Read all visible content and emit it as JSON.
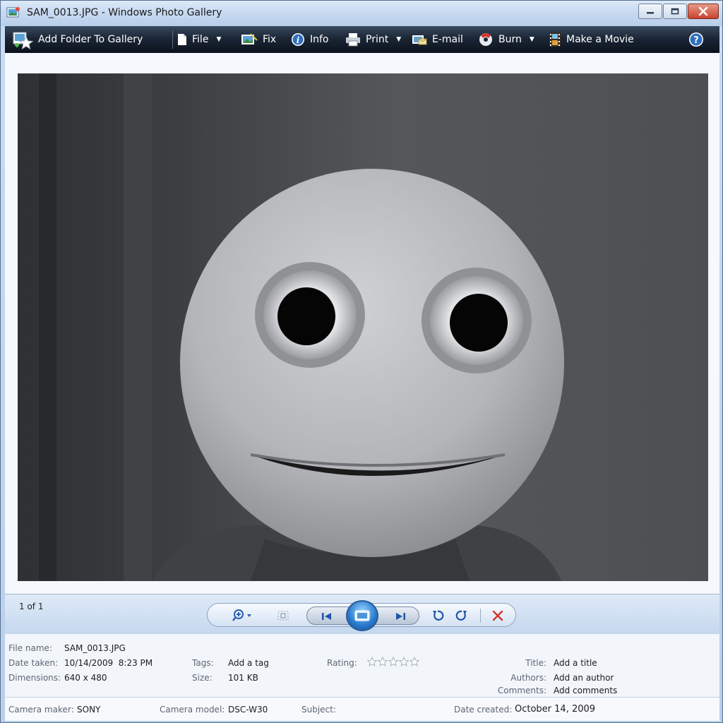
{
  "window": {
    "title": "SAM_0013.JPG - Windows Photo Gallery"
  },
  "toolbar": {
    "add_folder": "Add Folder To Gallery",
    "file": "File",
    "fix": "Fix",
    "info": "Info",
    "print": "Print",
    "email": "E-mail",
    "burn": "Burn",
    "make_movie": "Make a Movie"
  },
  "icons": {
    "add_folder": "add-folder-star-icon",
    "file": "document-icon",
    "fix": "fix-image-icon",
    "info": "info-icon",
    "print": "printer-icon",
    "email": "email-icon",
    "burn": "disc-burn-icon",
    "make_movie": "film-icon",
    "help": "help-icon"
  },
  "nav": {
    "counter": "1 of 1"
  },
  "info": {
    "file_name_label": "File name:",
    "file_name": "SAM_0013.JPG",
    "date_taken_label": "Date taken:",
    "date_taken": "10/14/2009  8:23 PM",
    "dimensions_label": "Dimensions:",
    "dimensions": "640 x 480",
    "tags_label": "Tags:",
    "tags": "Add a tag",
    "size_label": "Size:",
    "size": "101 KB",
    "rating_label": "Rating:",
    "rating_value": 0,
    "rating_max": 5,
    "title_label": "Title:",
    "title": "Add a title",
    "authors_label": "Authors:",
    "authors": "Add an author",
    "comments_label": "Comments:",
    "comments": "Add comments"
  },
  "meta": {
    "camera_maker_label": "Camera maker:",
    "camera_maker": "SONY",
    "camera_model_label": "Camera model:",
    "camera_model": "DSC-W30",
    "subject_label": "Subject:",
    "subject": "",
    "date_created_label": "Date created:",
    "date_created": "October 14, 2009"
  },
  "colors": {
    "toolbar_bg": "#1b2636",
    "accent_blue": "#2f7fd0",
    "delete_red": "#d4332a"
  }
}
